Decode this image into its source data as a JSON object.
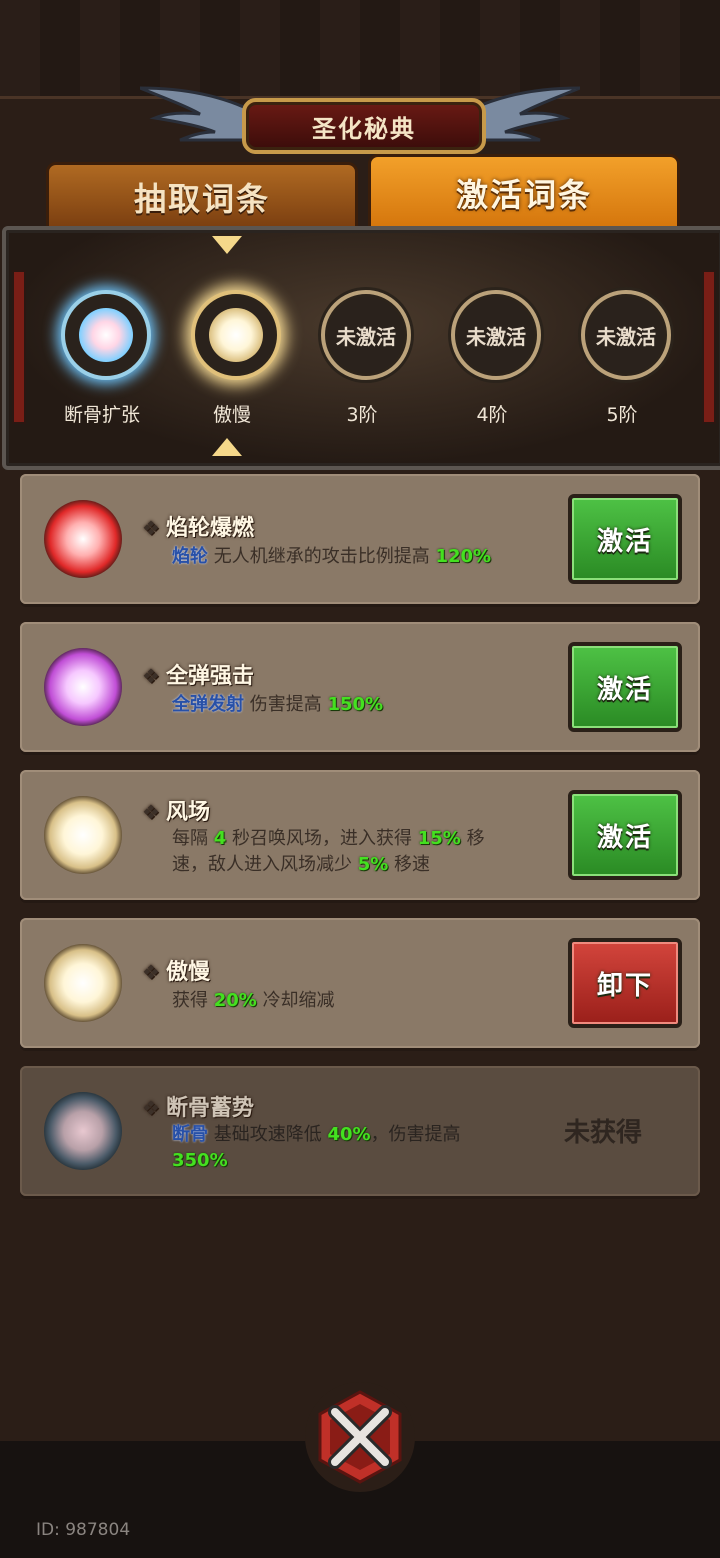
{
  "header": {
    "title": "圣化秘典"
  },
  "tabs": [
    {
      "label": "抽取词条",
      "active": false
    },
    {
      "label": "激活词条",
      "active": true
    }
  ],
  "slots": [
    {
      "label": "断骨扩张",
      "state": "filled",
      "orb_color": "#bfe6ff"
    },
    {
      "label": "傲慢",
      "state": "filled",
      "orb_color": "#fff2c8"
    },
    {
      "label": "3阶",
      "state": "empty",
      "text": "未激活"
    },
    {
      "label": "4阶",
      "state": "empty",
      "text": "未激活"
    },
    {
      "label": "5阶",
      "state": "empty",
      "text": "未激活"
    }
  ],
  "cards": [
    {
      "title": "焰轮爆燃",
      "keyword": "焰轮",
      "desc_parts": [
        "无人机继承的攻击比例提高",
        "120%"
      ],
      "button": "激活",
      "button_type": "green",
      "orb_color": "#ff5a5a"
    },
    {
      "title": "全弹强击",
      "keyword": "全弹发射",
      "desc_parts": [
        "伤害提高",
        "150%"
      ],
      "button": "激活",
      "button_type": "green",
      "orb_color": "#e37ef0"
    },
    {
      "title": "风场",
      "desc_line1": [
        "每隔",
        "4",
        "秒召唤风场，进入获得",
        "15%",
        "移"
      ],
      "desc_line2": [
        "速，敌人进入风场减少",
        "5%",
        "移速"
      ],
      "button": "激活",
      "button_type": "green",
      "orb_color": "#fff0c0"
    },
    {
      "title": "傲慢",
      "desc_parts": [
        "获得",
        "20%",
        "冷却缩减"
      ],
      "button": "卸下",
      "button_type": "red",
      "orb_color": "#fff0c0"
    },
    {
      "title": "断骨蓄势",
      "keyword": "断骨",
      "desc_line1": [
        "基础攻速降低",
        "40%",
        "，伤害提高"
      ],
      "desc_line2": [
        "350%"
      ],
      "status": "未获得",
      "orb_color": "#cfa7b0"
    }
  ],
  "footer": {
    "id_text": "ID: 987804",
    "close_icon": "close-x-icon"
  },
  "colors": {
    "accent_green": "#44e020",
    "keyword_blue": "#2750a8",
    "tab_active": "#f2a02a"
  }
}
